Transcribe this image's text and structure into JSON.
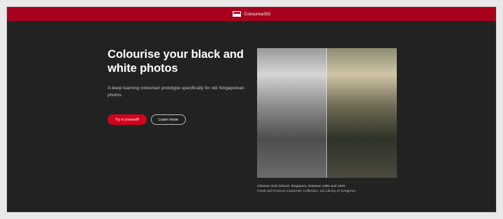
{
  "topbar": {
    "brand": "ColouriseSG",
    "icon": "singapore-flag-icon",
    "color": "#a8001c"
  },
  "hero": {
    "headline": "Colourise your black and white photos",
    "subtitle": "A deep learning colouriser prototype specifically for old Singaporean photos.",
    "primary_button": "Try it yourself!",
    "secondary_button": "Learn more",
    "accent": "#d3001d"
  },
  "photo": {
    "caption": "Chinese Girls School, Singapore, between 1890 and 1920",
    "credit": "Frank and Frances Carpenter Collection, US Library of Congress."
  }
}
